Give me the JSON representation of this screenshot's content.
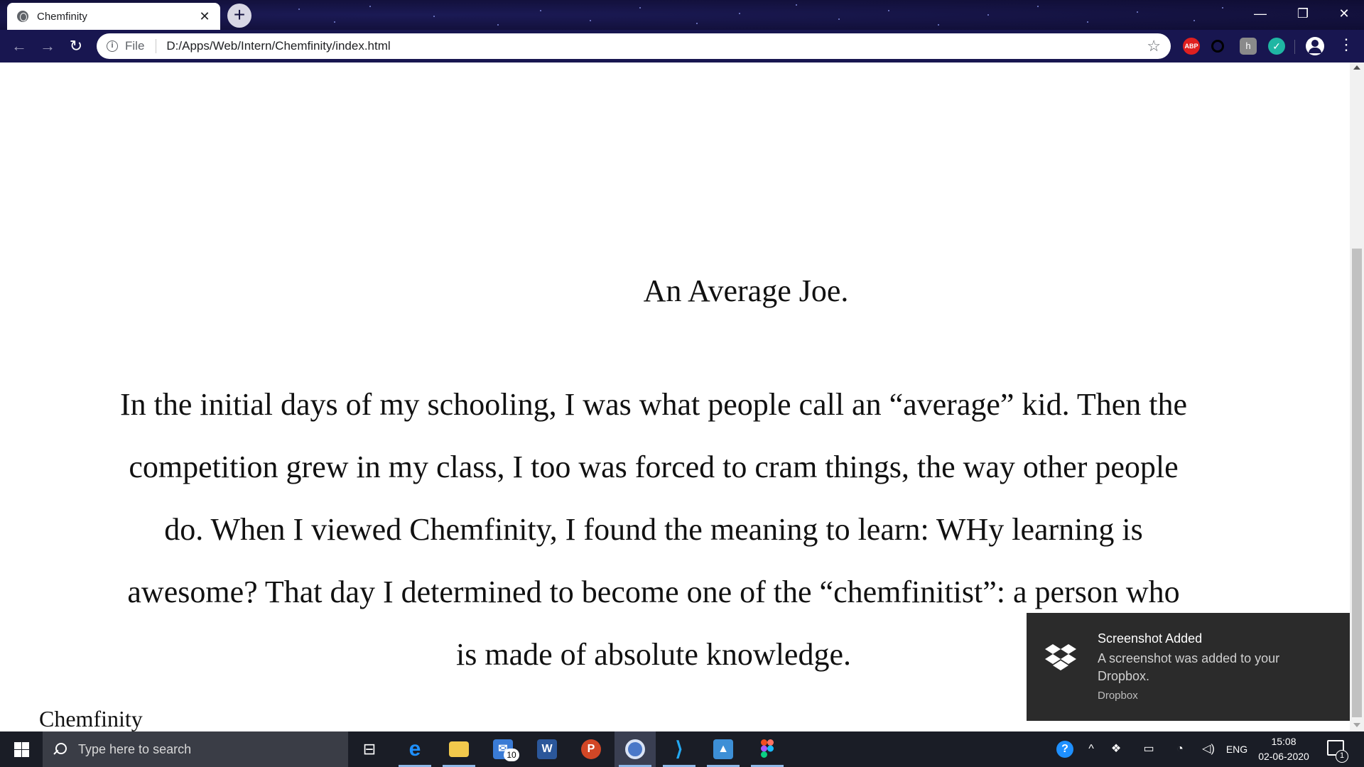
{
  "browser": {
    "tab_title": "Chemfinity",
    "tab_close": "✕",
    "new_tab": "+",
    "window_controls": {
      "minimize": "—",
      "restore": "❐",
      "close": "✕"
    },
    "nav": {
      "back": "←",
      "forward": "→",
      "reload": "↻"
    },
    "omnibox": {
      "scheme_label": "File",
      "url": "D:/Apps/Web/Intern/Chemfinity/index.html",
      "bookmark": "☆"
    },
    "extensions": [
      {
        "name": "adblock-plus-icon",
        "label": "ABP"
      },
      {
        "name": "ring-extension-icon",
        "label": ""
      },
      {
        "name": "puzzle-extension-icon",
        "label": "h"
      },
      {
        "name": "green-extension-icon",
        "label": "✓"
      }
    ],
    "menu": "⋮"
  },
  "page": {
    "heading": "An Average Joe.",
    "story": "In the initial days of my schooling, I was what people call an “average” kid. Then the competition grew in my class, I too was forced to cram things, the way other people do. When I viewed Chemfinity, I found the meaning to learn: WHy learning is awesome? That day I determined to become one of the “chemfinitist”: a person who is made of absolute knowledge.",
    "footer_brand": "Chemfinity"
  },
  "toast": {
    "title": "Screenshot Added",
    "body": "A screenshot was added to your Dropbox.",
    "source": "Dropbox"
  },
  "taskbar": {
    "search_placeholder": "Type here to search",
    "mail_badge": "10",
    "tray": {
      "language": "ENG",
      "time": "15:08",
      "date": "02-06-2020",
      "notification_count": "1"
    }
  }
}
